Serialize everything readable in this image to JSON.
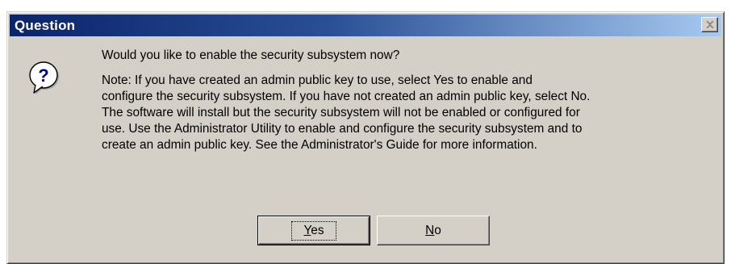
{
  "window": {
    "title": "Question",
    "close_icon": "close-icon"
  },
  "icon": {
    "name": "question-icon",
    "glyph": "?"
  },
  "message": {
    "question": "Would you like to enable the security subsystem now?",
    "note": " Note:  If you have created an admin public key to use, select Yes to enable and\nconfigure the security subsystem.  If you have not created an admin public key, select No.\n The software will install but the security subsystem will not be enabled or configured for\nuse.  Use the Administrator Utility to enable and configure the security subsystem and to\ncreate an admin public key.  See the Administrator's Guide for more information."
  },
  "buttons": {
    "yes": {
      "mnemonic": "Y",
      "rest": "es"
    },
    "no": {
      "mnemonic": "N",
      "rest": "o"
    }
  },
  "colors": {
    "face": "#d4d0c8",
    "title_start": "#0a246a",
    "title_end": "#a6caf0",
    "icon_blue": "#000080"
  }
}
